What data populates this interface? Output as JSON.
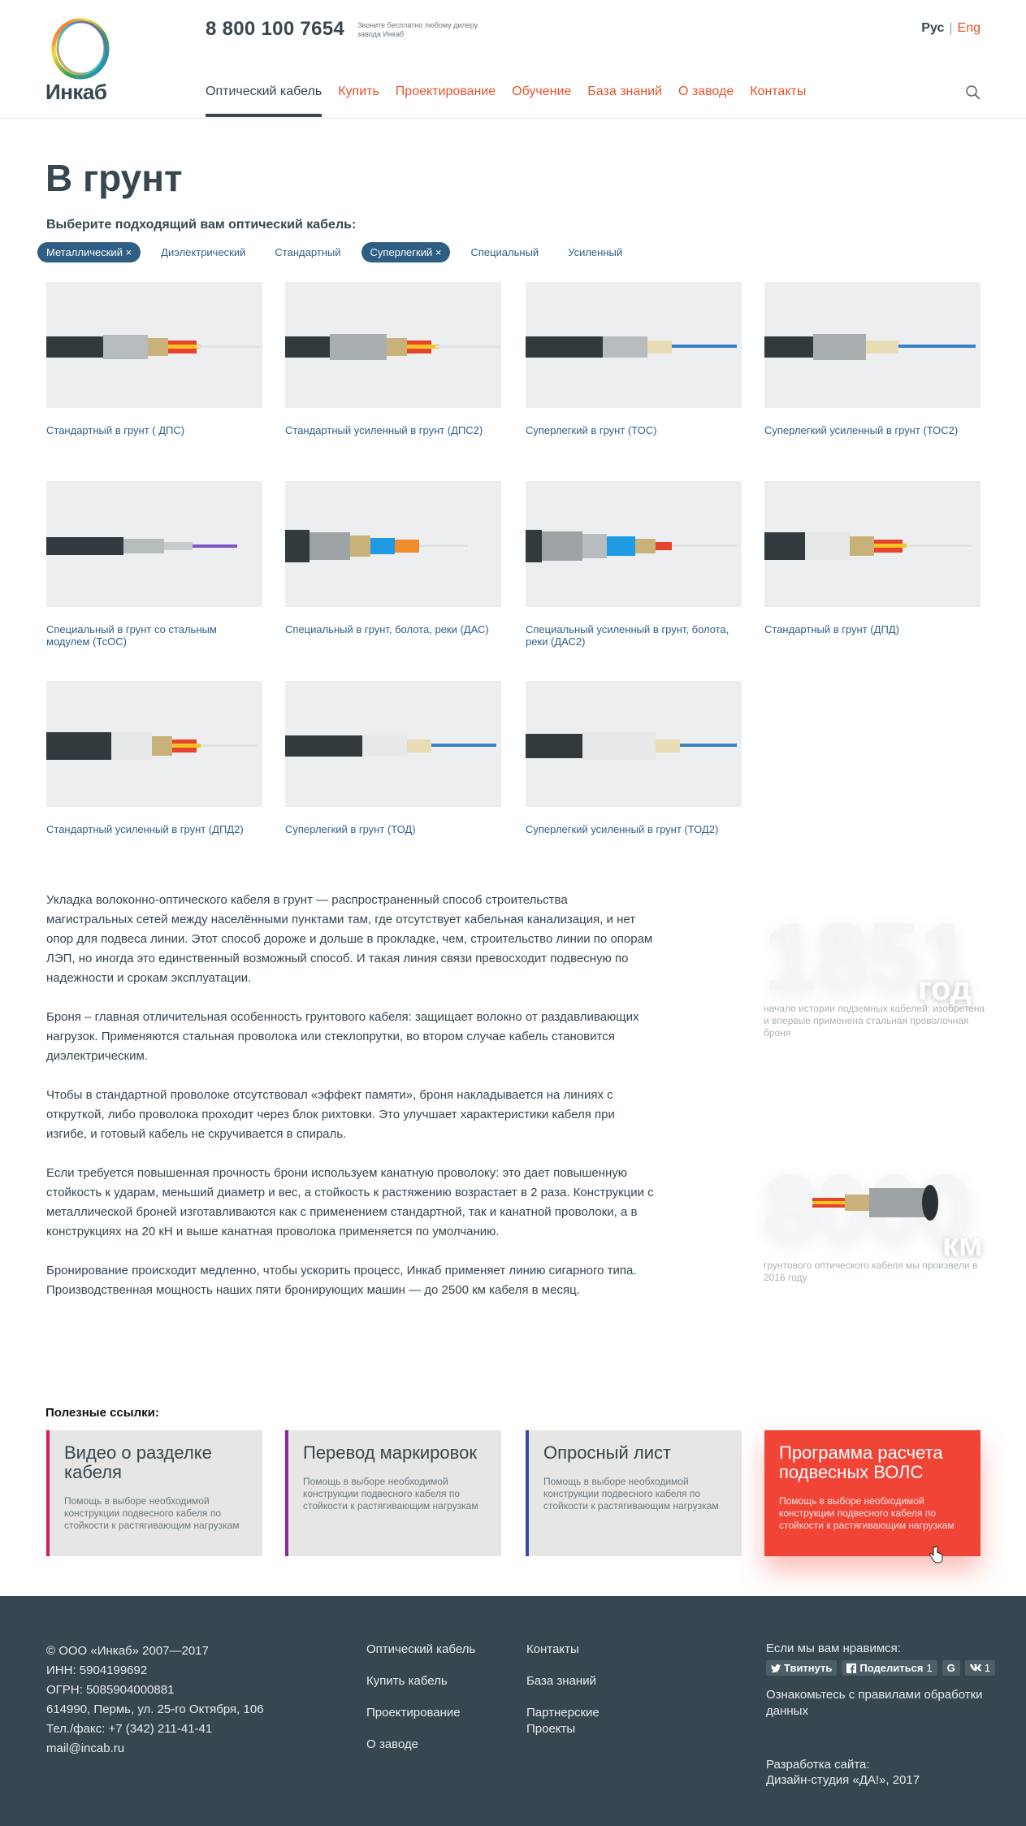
{
  "header": {
    "logo_text": "Инкаб",
    "phone": "8 800 100 7654",
    "phone_note": "Звоните бесплатно любому дилеру завода Инкаб",
    "lang_ru": "Рус",
    "lang_sep": "|",
    "lang_en": "Eng",
    "nav": [
      {
        "label": "Оптический кабель",
        "active": true
      },
      {
        "label": "Купить"
      },
      {
        "label": "Проектирование"
      },
      {
        "label": "Обучение"
      },
      {
        "label": "База знаний"
      },
      {
        "label": "О заводе"
      },
      {
        "label": "Контакты"
      }
    ],
    "search_icon": "search-icon"
  },
  "main": {
    "title": "В грунт",
    "filter_label": "Выберите подходящий вам оптический кабель:",
    "filters": [
      {
        "label": "Металлический ×",
        "active": true
      },
      {
        "label": "Диэлектрический",
        "active": false
      },
      {
        "label": "Стандартный",
        "active": false
      },
      {
        "label": "Суперлегкий ×",
        "active": true
      },
      {
        "label": "Специальный",
        "active": false
      },
      {
        "label": "Усиленный",
        "active": false
      }
    ],
    "products": [
      {
        "label": "Стандартный в грунт ( ДПС)"
      },
      {
        "label": "Стандартный усиленный в грунт (ДПС2)"
      },
      {
        "label": "Суперлегкий в грунт (ТОС)"
      },
      {
        "label": "Суперлегкий усиленный в грунт (ТОС2)"
      },
      {
        "label": "Специальный в грунт со стальным модулем (ТсОС)"
      },
      {
        "label": "Специальный в грунт, болота, реки  (ДАС)"
      },
      {
        "label": "Специальный усиленный в грунт, болота, реки  (ДАС2)"
      },
      {
        "label": "Стандартный в грунт (ДПД)"
      },
      {
        "label": "Стандартный усиленный в грунт (ДПД2)"
      },
      {
        "label": "Суперлегкий в грунт  (ТОД)"
      },
      {
        "label": "Суперлегкий усиленный в грунт (ТОД2)"
      }
    ],
    "paragraphs": [
      "Укладка волоконно-оптического кабеля в грунт — распространенный способ строительства магистральных сетей между населёнными пунктами там, где отсутствует кабельная канализация, и нет опор для подвеса линии. Этот способ дороже и дольше в прокладке, чем, строительство линии по опорам ЛЭП, но иногда это единственный возможный способ. И такая линия связи превосходит подвесную по надежности и срокам эксплуатации.",
      "Броня – главная отличительная особенность грунтового кабеля: защищает волокно от раздавливающих нагрузок. Применяются стальная проволока или стеклопрутки, во втором случае кабель становится диэлектрическим.",
      "Чтобы в стандартной проволоке отсутствовал «эффект памяти», броня накладывается на линиях с откруткой, либо проволока проходит через блок рихтовки. Это улучшает характеристики кабеля при изгибе, и готовый кабель не скручивается в спираль.",
      "Если требуется повышенная прочность брони используем канатную проволоку: это дает повышенную стойкость к ударам, меньший диаметр и вес, а стойкость к растяжению возрастает в 2 раза. Конструкции с металлической броней изготавливаются как с применением стандартной, так и канатной проволоки, а в конструкциях на 20 кН и выше канатная проволока применяется по умолчанию.",
      "Бронирование происходит медленно, чтобы ускорить процесс, Инкаб применяет линию сигарного типа. Производственная мощность наших пяти бронирующих машин — до 2500 км кабеля в месяц."
    ],
    "stat1": {
      "value": "1851",
      "unit": "год",
      "caption": "начало истории подземных кабелей: изобретена и впервые применена стальная проволочная броня"
    },
    "stat2": {
      "value": "8000",
      "unit": "км",
      "caption": "грунтового оптического кабеля мы произвели в 2016 году"
    },
    "links_title": "Полезные ссылки:",
    "links": [
      {
        "title": "Видео о разделке кабеля",
        "desc": "Помощь в выборе необходимой конструкции подвесного кабеля по стойкости к растягивающим нагрузкам",
        "accent": "#d81b60"
      },
      {
        "title": "Перевод маркировок",
        "desc": "Помощь в выборе необходимой конструкции подвесного кабеля по стойкости к растягивающим нагрузкам",
        "accent": "#8e24aa"
      },
      {
        "title": "Опросный лист",
        "desc": "Помощь в выборе необходимой конструкции подвесного кабеля по стойкости к растягивающим нагрузкам",
        "accent": "#3949ab"
      },
      {
        "title": "Программа расчета подвесных ВОЛС",
        "desc": "Помощь в выборе необходимой конструкции подвесного кабеля по стойкости к растягивающим нагрузкам",
        "accent": "#f04437"
      }
    ]
  },
  "footer": {
    "company": [
      "© ООО «Инкаб» 2007—2017",
      "ИНН: 5904199692",
      "ОГРН: 5085904000881",
      "614990, Пермь, ул. 25-го Октября, 106",
      "Тел./факс: +7 (342) 211-41-41",
      "mail@incab.ru"
    ],
    "col2": [
      "Оптический кабель",
      "Купить кабель",
      "Проектирование",
      "О заводе"
    ],
    "col3": [
      "Контакты",
      "База знаний",
      "Партнерские Проекты"
    ],
    "social_title": "Если мы вам нравимся:",
    "social": {
      "twitter": "Твитнуть",
      "facebook": "Поделиться",
      "facebook_count": "1",
      "google": "G",
      "vk_count": "1"
    },
    "policy": "Ознакомьтесь с правилами обработки данных",
    "dev_title": "Разработка сайта:",
    "dev_name": "Дизайн-студия «ДА!», 2017"
  },
  "colors": {
    "accent": "#e5532d",
    "dark": "#37474f",
    "link": "#2f5f8a",
    "chip": "#2e5e84",
    "red_card": "#f04437"
  }
}
